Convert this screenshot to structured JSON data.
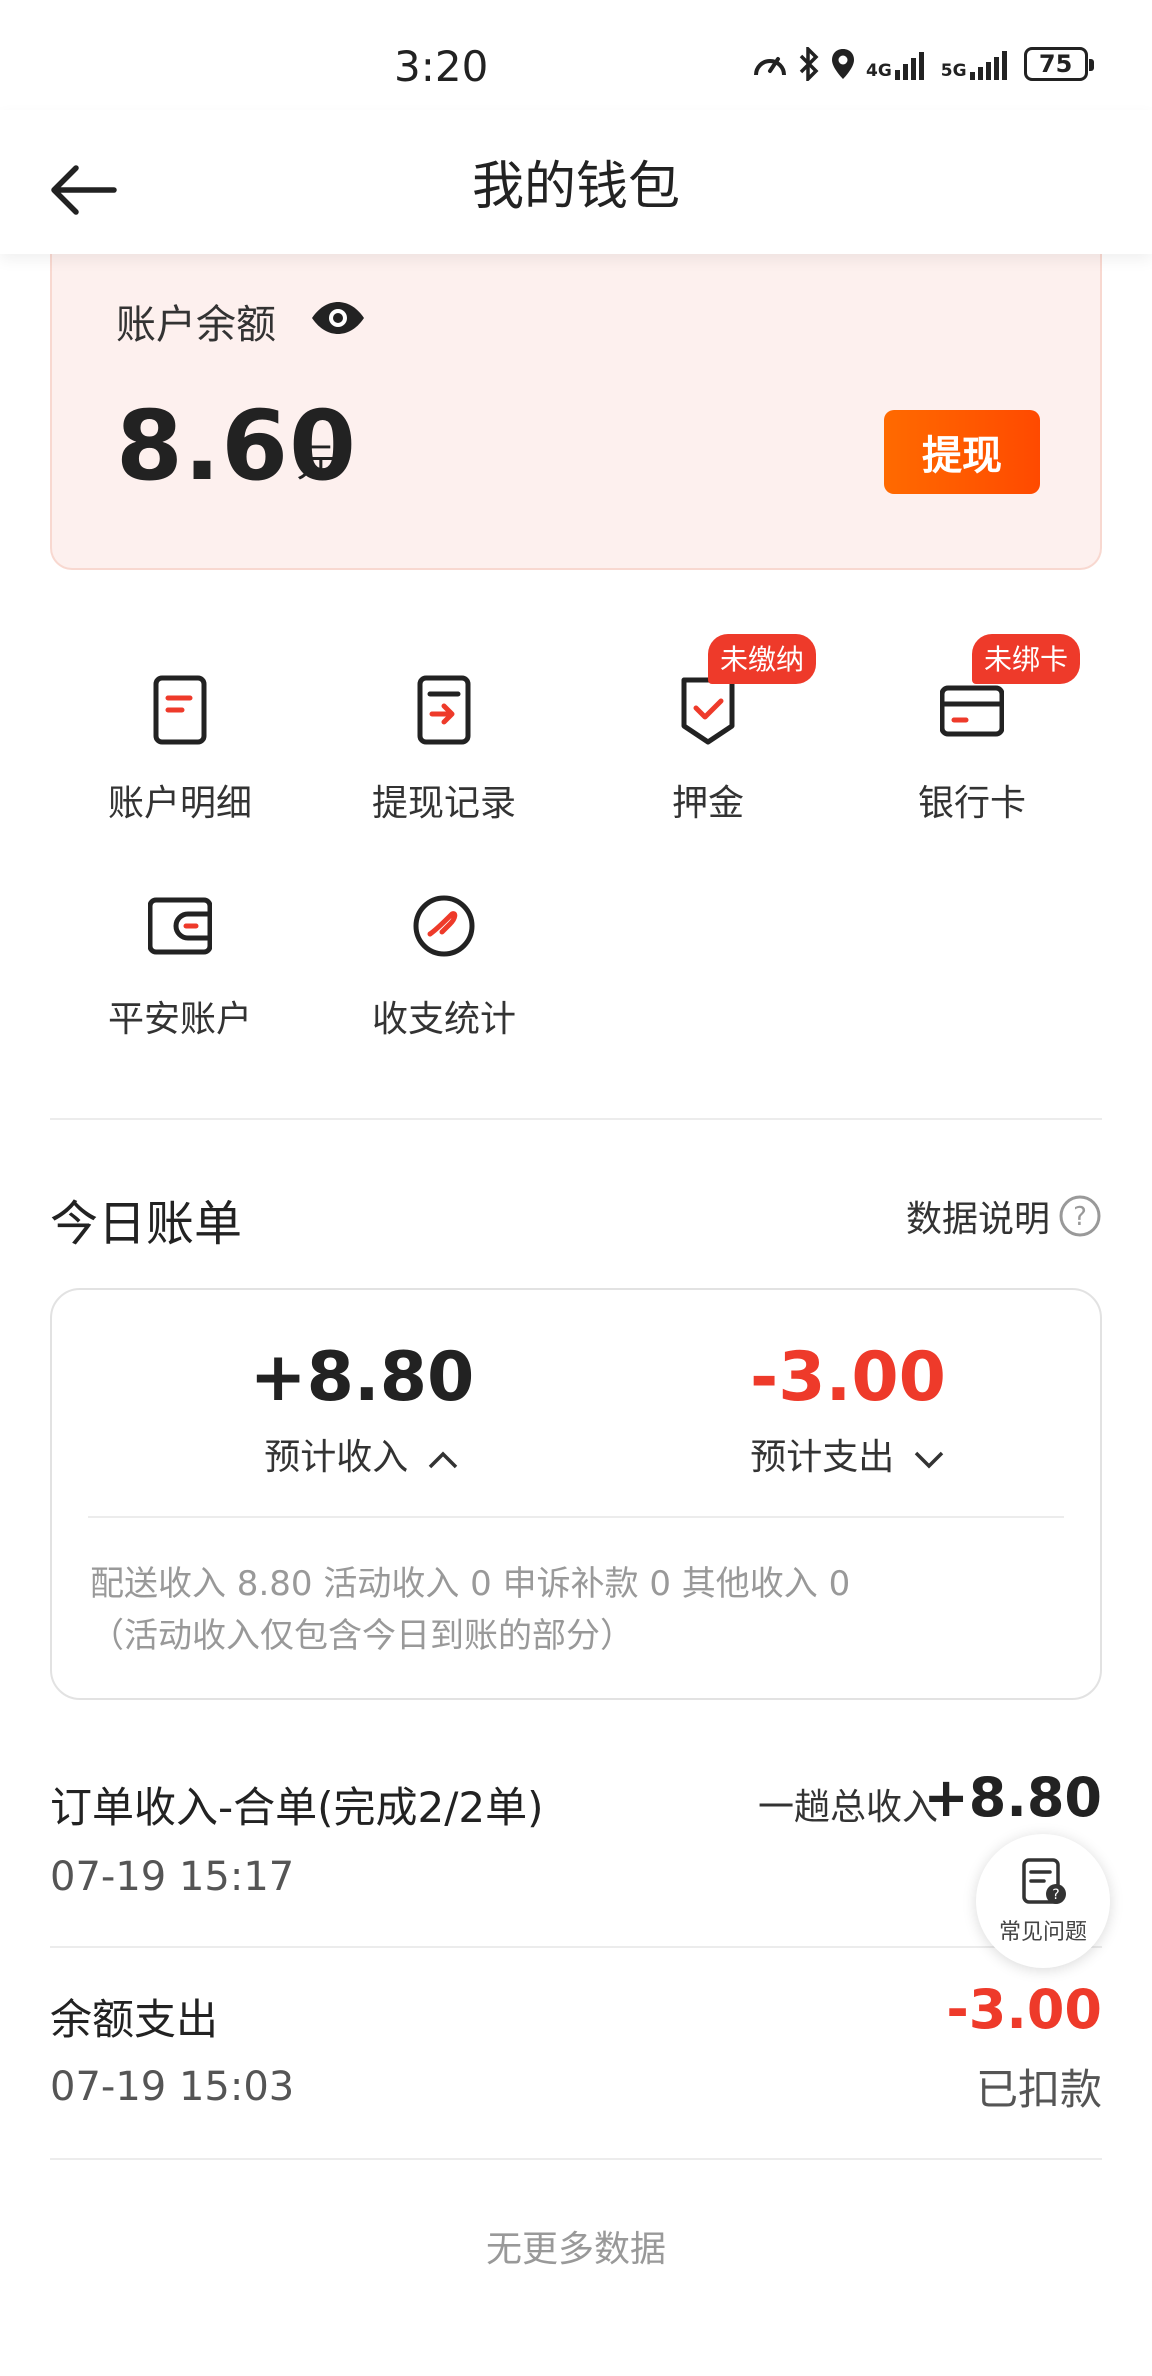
{
  "status_bar": {
    "time": "3:20",
    "battery": "75",
    "net1": "4G",
    "net2": "5G"
  },
  "header": {
    "title": "我的钱包"
  },
  "balance": {
    "label": "账户余额",
    "amount": "8.60",
    "unit": "元",
    "withdraw_label": "提现"
  },
  "grid": [
    {
      "label": "账户明细",
      "icon": "document-icon",
      "tag": ""
    },
    {
      "label": "提现记录",
      "icon": "withdraw-record-icon",
      "tag": ""
    },
    {
      "label": "押金",
      "icon": "shield-check-icon",
      "tag": "未缴纳"
    },
    {
      "label": "银行卡",
      "icon": "bank-card-icon",
      "tag": "未绑卡"
    },
    {
      "label": "平安账户",
      "icon": "wallet-icon",
      "tag": ""
    },
    {
      "label": "收支统计",
      "icon": "stats-circle-icon",
      "tag": ""
    }
  ],
  "today_bill": {
    "title": "今日账单",
    "data_explain": "数据说明",
    "income_value": "+8.80",
    "income_label": "预计收入",
    "expense_value": "-3.00",
    "expense_label": "预计支出",
    "detail_line1": "配送收入 8.80 活动收入 0 申诉补款 0 其他收入 0",
    "detail_line2": "（活动收入仅包含今日到账的部分）"
  },
  "transactions": [
    {
      "title": "订单收入-合单(完成2/2单)",
      "time": "07-19 15:17",
      "note": "一趟总收入",
      "amount": "+8.80",
      "status": ""
    },
    {
      "title": "余额支出",
      "time": "07-19 15:03",
      "note": "",
      "amount": "-3.00",
      "status": "已扣款"
    }
  ],
  "faq": {
    "label": "常见问题"
  },
  "footer": {
    "no_more": "无更多数据"
  },
  "colors": {
    "accent": "#ff5a00",
    "negative": "#ee3a2a",
    "tag_red": "#ee3a2a",
    "card_bg": "#fdf0ee"
  }
}
